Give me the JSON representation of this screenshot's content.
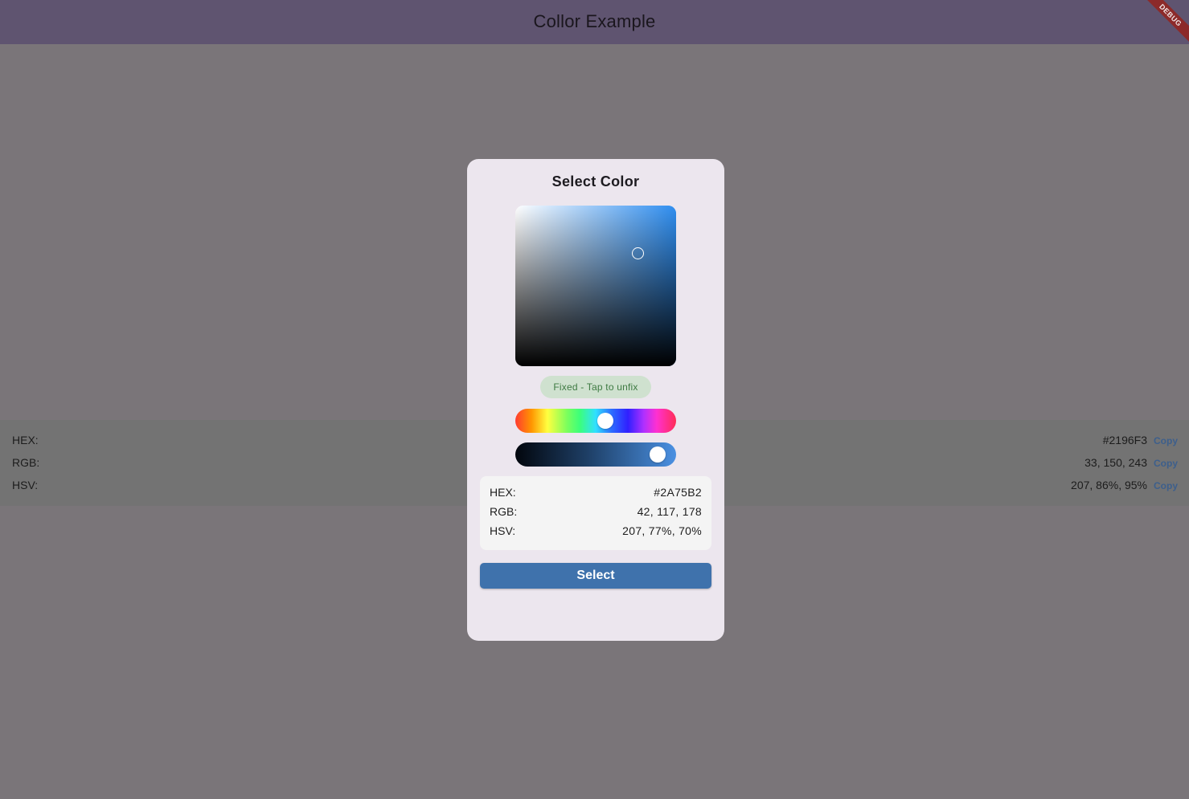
{
  "app_bar": {
    "title": "Collor Example",
    "debug_banner": "DEBUG",
    "color": "#5f5470"
  },
  "background_info": {
    "rows": [
      {
        "label": "HEX:",
        "value": "#2196F3",
        "action": "Copy"
      },
      {
        "label": "RGB:",
        "value": "33, 150, 243",
        "action": "Copy"
      },
      {
        "label": "HSV:",
        "value": "207, 86%, 95%",
        "action": "Copy"
      }
    ]
  },
  "dialog": {
    "title": "Select Color",
    "fixed_chip": "Fixed - Tap to unfix",
    "hue_slider_level": 0.57,
    "value_slider_level": 0.95,
    "info": {
      "rows": [
        {
          "label": "HEX:",
          "value": "#2A75B2"
        },
        {
          "label": "RGB:",
          "value": "42, 117, 178"
        },
        {
          "label": "HSV:",
          "value": "207, 77%, 70%"
        }
      ]
    },
    "select_button": "Select",
    "colors": {
      "accent": "#3f72ac",
      "selected": "#2A75B2",
      "chip_bg": "#cfe1cf",
      "chip_text": "#3e7a42"
    }
  }
}
